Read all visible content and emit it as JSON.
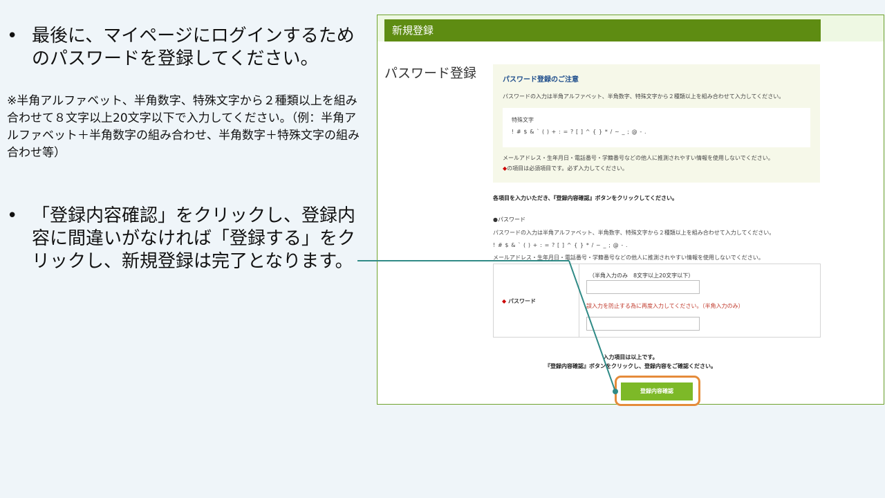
{
  "instructions": {
    "bullet_symbol": "•",
    "step1": "最後に、マイページにログインするためのパスワードを登録してください。",
    "note": "※半角アルファベット、半角数字、特殊文字から２種類以上を組み合わせて８文字以上20文字以下で入力してください。（例：半角アルファベット＋半角数字の組み合わせ、半角数字＋特殊文字の組み合わせ等）",
    "step2": "「登録内容確認」をクリックし、登録内容に間違いがなければ「登録する」をクリックし、新規登録は完了となります。"
  },
  "screen": {
    "header_title": "新規登録",
    "section_title": "パスワード登録",
    "notice": {
      "title": "パスワード登録のご注意",
      "text": "パスワードの入力は半角アルファベット、半角数字、特殊文字から２種類以上を組み合わせて入力してください。",
      "special_label": "特殊文字",
      "special_chars": "! # $ & ` ( ) + : = ? [ ] ^ { } * / ~ _ ; @ - .",
      "warning": "メールアドレス・生年月日・電話番号・学籍番号などの他人に推測されやすい情報を使用しないでください。",
      "required_mark": "◆",
      "required_note": "の項目は必須項目です。必ず入力してください。"
    },
    "instruction": "各項目を入力いただき、『登録内容確認』ボタンをクリックしてください。",
    "password_section": {
      "title": "●パスワード",
      "desc": "パスワードの入力は半角アルファベット、半角数字、特殊文字から２種類以上を組み合わせて入力してください。",
      "chars": "! # $ & ` ( ) + : = ? [ ] ^ { } * / ~ _ ; @ - .",
      "warning": "メールアドレス・生年月日・電話番号・学籍番号などの他人に推測されやすい情報を使用しないでください。"
    },
    "form": {
      "required_mark": "◆",
      "label": "パスワード",
      "hint": "（半角入力のみ　8文字以上20文字以下）",
      "confirm_hint": "誤入力を防止する為に再度入力してください。（半角入力のみ）",
      "password_value": "",
      "confirm_value": ""
    },
    "end_text1": "入力項目は以上です。",
    "end_text2": "『登録内容確認』ボタンをクリックし、登録内容をご確認ください。",
    "confirm_button": "登録内容確認"
  },
  "colors": {
    "header_green": "#5e8c12",
    "button_green": "#7db928",
    "highlight_orange": "#e58b3a",
    "connector_teal": "#2f8a86"
  }
}
